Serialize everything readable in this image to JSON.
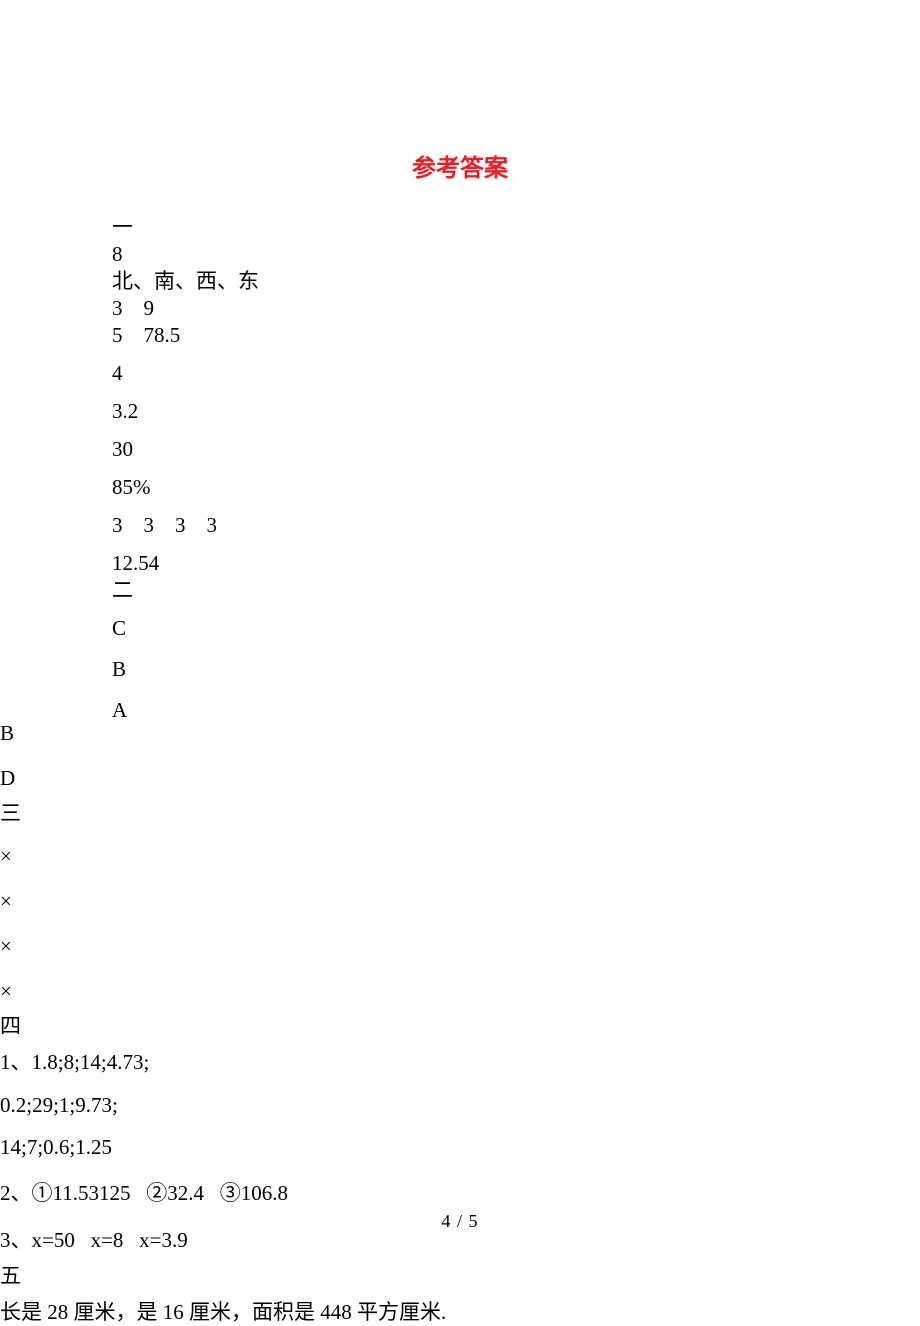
{
  "title": "参考答案",
  "sections": {
    "one": {
      "heading": "一",
      "l1": "8",
      "l2": "北、南、西、东",
      "l3": "3    9",
      "l4": "5    78.5",
      "l5": "4",
      "l6": "3.2",
      "l7": "30",
      "l8": "85%",
      "l9": "3    3    3    3",
      "l10": "12.54"
    },
    "two": {
      "heading": "二",
      "a1": "C",
      "a2": "B",
      "a3": "A",
      "a4": "B",
      "a5": "D"
    },
    "three": {
      "heading": "三",
      "a1": "×",
      "a2": "×",
      "a3": "×",
      "a4": "×"
    },
    "four": {
      "heading": "四",
      "l1": "1、1.8;8;14;4.73;",
      "l2": "0.2;29;1;9.73;",
      "l3": "14;7;0.6;1.25",
      "l4": "2、①11.53125   ②32.4   ③106.8",
      "l5": "3、x=50   x=8   x=3.9"
    },
    "five": {
      "heading": "五",
      "l1": "长是 28 厘米，是 16 厘米，面积是 448 平方厘米."
    }
  },
  "pagenum": "4 / 5"
}
